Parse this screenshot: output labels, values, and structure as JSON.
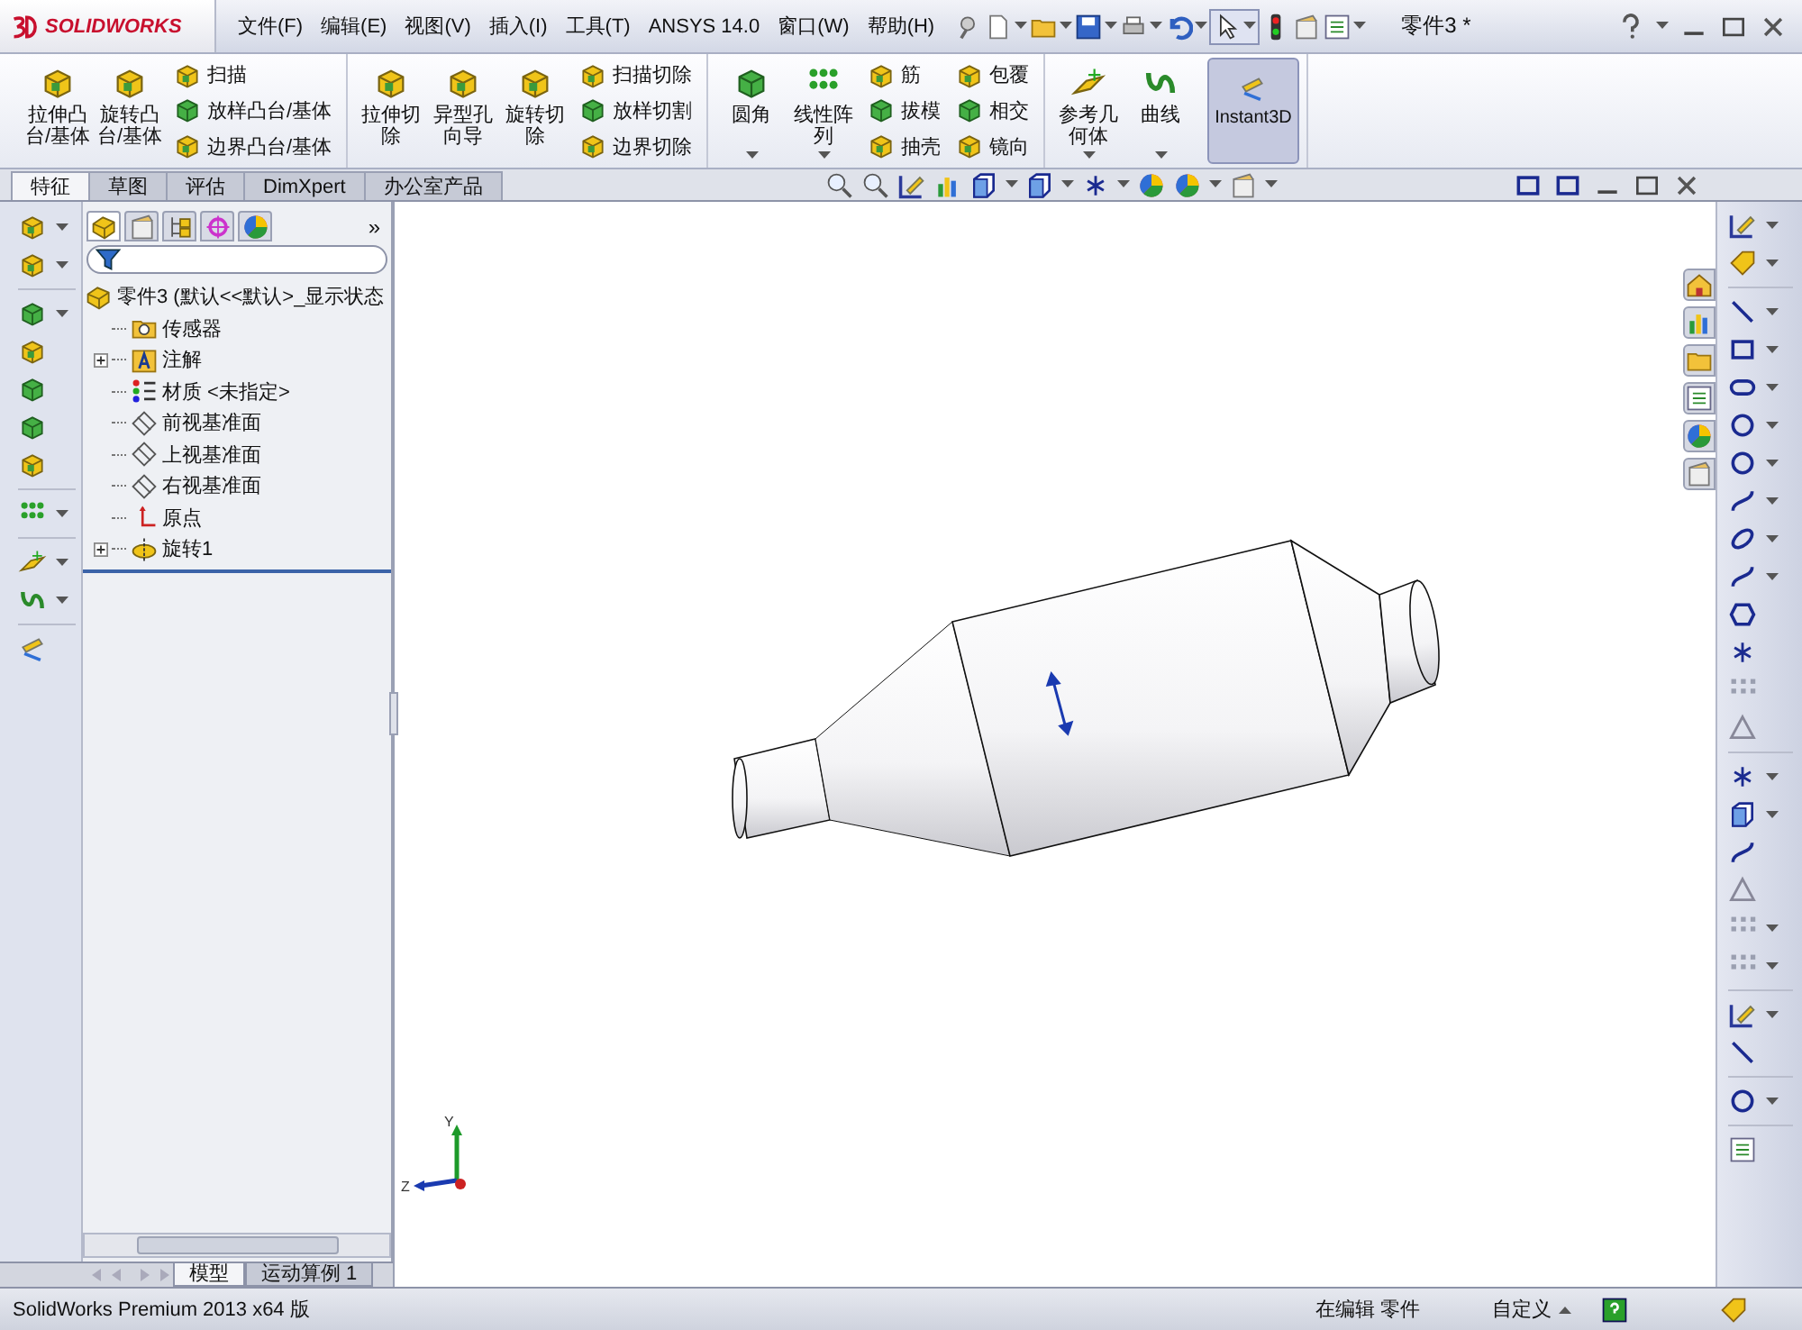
{
  "title_bar": {
    "logo": "SOLIDWORKS",
    "menu": [
      "文件(F)",
      "编辑(E)",
      "视图(V)",
      "插入(I)",
      "工具(T)",
      "ANSYS 14.0",
      "窗口(W)",
      "帮助(H)"
    ],
    "document_title": "零件3 *"
  },
  "ribbon": {
    "groups": [
      {
        "items": [
          {
            "kind": "large",
            "label": "拉伸凸台/基体",
            "dropdown": false
          },
          {
            "kind": "large",
            "label": "旋转凸台/基体",
            "dropdown": false
          },
          {
            "kind": "stack",
            "labels": [
              "扫描",
              "放样凸台/基体",
              "边界凸台/基体"
            ]
          }
        ]
      },
      {
        "items": [
          {
            "kind": "large",
            "label": "拉伸切除",
            "dropdown": false
          },
          {
            "kind": "large",
            "label": "异型孔向导",
            "dropdown": false
          },
          {
            "kind": "large",
            "label": "旋转切除",
            "dropdown": false
          },
          {
            "kind": "stack",
            "labels": [
              "扫描切除",
              "放样切割",
              "边界切除"
            ]
          }
        ]
      },
      {
        "items": [
          {
            "kind": "large",
            "label": "圆角",
            "dropdown": true
          },
          {
            "kind": "large",
            "label": "线性阵列",
            "dropdown": true
          },
          {
            "kind": "stack",
            "labels": [
              "筋",
              "拔模",
              "抽壳"
            ]
          },
          {
            "kind": "stack",
            "labels": [
              "包覆",
              "相交",
              "镜向"
            ]
          }
        ]
      },
      {
        "items": [
          {
            "kind": "large",
            "label": "参考几何体",
            "dropdown": true
          },
          {
            "kind": "large",
            "label": "曲线",
            "dropdown": true
          },
          {
            "kind": "toggle",
            "label": "Instant3D",
            "selected": true
          }
        ]
      }
    ]
  },
  "tabs": [
    {
      "label": "特征",
      "selected": true
    },
    {
      "label": "草图",
      "selected": false
    },
    {
      "label": "评估",
      "selected": false
    },
    {
      "label": "DimXpert",
      "selected": false
    },
    {
      "label": "办公室产品",
      "selected": false
    }
  ],
  "feature_panel": {
    "tabs": [
      {
        "selected": true
      },
      {
        "selected": false
      },
      {
        "selected": false
      },
      {
        "selected": false
      },
      {
        "selected": false
      }
    ],
    "overflow": "»",
    "tree": {
      "label": "零件3  (默认<<默认>_显示状态",
      "children": [
        {
          "kind": "sensor",
          "label": "传感器",
          "expandable": false
        },
        {
          "kind": "annotation",
          "label": "注解",
          "expandable": true
        },
        {
          "kind": "material",
          "label": "材质 <未指定>",
          "expandable": false
        },
        {
          "kind": "plane",
          "label": "前视基准面",
          "expandable": false
        },
        {
          "kind": "plane",
          "label": "上视基准面",
          "expandable": false
        },
        {
          "kind": "plane",
          "label": "右视基准面",
          "expandable": false
        },
        {
          "kind": "origin",
          "label": "原点",
          "expandable": false
        },
        {
          "kind": "feature",
          "label": "旋转1",
          "expandable": true
        }
      ]
    }
  },
  "bottom_tabs": [
    {
      "label": "模型",
      "selected": true
    },
    {
      "label": "运动算例 1",
      "selected": false
    }
  ],
  "viewport": {
    "triad_labels": [
      "Y",
      "Z"
    ]
  },
  "status_bar": {
    "product": "SolidWorks Premium 2013 x64 版",
    "mode": "在编辑 零件",
    "customize": "自定义"
  }
}
